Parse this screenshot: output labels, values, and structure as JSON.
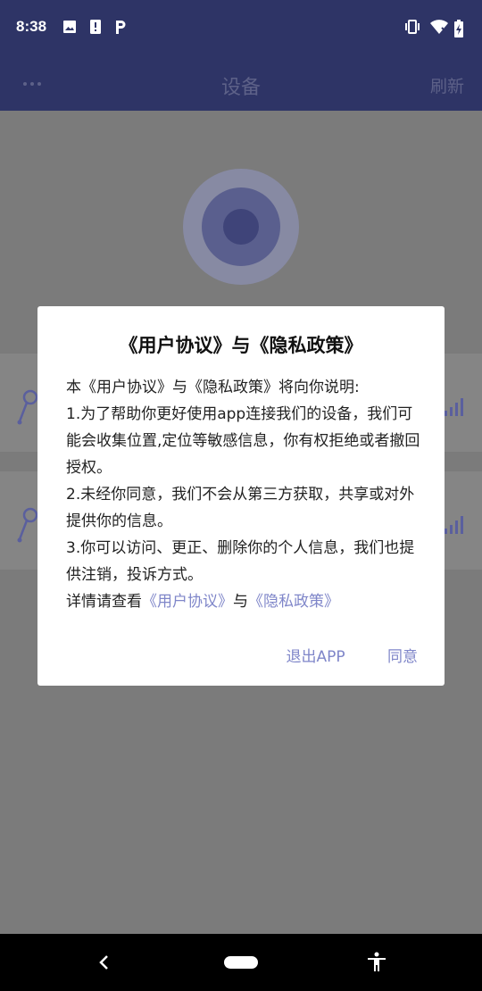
{
  "status_bar": {
    "time": "8:38"
  },
  "app_bar": {
    "title": "设备",
    "refresh_label": "刷新"
  },
  "dialog": {
    "title": "《用户协议》与《隐私政策》",
    "intro": "本《用户协议》与《隐私政策》将向你说明:",
    "item1": "1.为了帮助你更好使用app连接我们的设备，我们可能会收集位置,定位等敏感信息，你有权拒绝或者撤回授权。",
    "item2": "2.未经你同意，我们不会从第三方获取，共享或对外提供你的信息。",
    "item3": "3.你可以访问、更正、删除你的个人信息，我们也提供注销，投诉方式。",
    "details_prefix": "详情请查看",
    "user_agreement_link": "《用户协议》",
    "and": "与",
    "privacy_policy_link": "《隐私政策》",
    "exit_label": "退出APP",
    "agree_label": "同意"
  },
  "colors": {
    "primary": "#2e3466",
    "accent": "#7f86c9",
    "scrim": "#7b7b7b"
  },
  "icons": [
    "image-icon",
    "alert-icon",
    "parking-icon",
    "vibrate-icon",
    "wifi-icon",
    "battery-icon",
    "more-icon",
    "device-icon",
    "signal-icon",
    "back-icon",
    "accessibility-icon"
  ]
}
